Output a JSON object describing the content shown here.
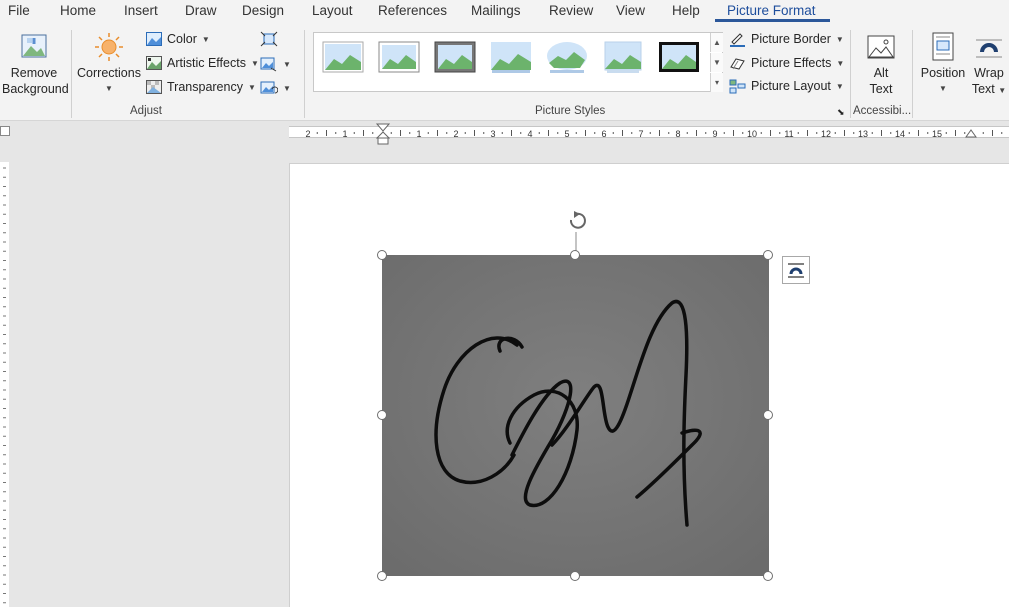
{
  "tabs": [
    {
      "label": "File"
    },
    {
      "label": "Home"
    },
    {
      "label": "Insert"
    },
    {
      "label": "Draw"
    },
    {
      "label": "Design"
    },
    {
      "label": "Layout"
    },
    {
      "label": "References"
    },
    {
      "label": "Mailings"
    },
    {
      "label": "Review"
    },
    {
      "label": "View"
    },
    {
      "label": "Help"
    },
    {
      "label": "Picture Format"
    }
  ],
  "active_tab": "Picture Format",
  "ribbon": {
    "adjust": {
      "remove_background": "Remove Background",
      "remove_background_l1": "Remove",
      "remove_background_l2": "Background",
      "corrections": "Corrections",
      "color": "Color",
      "artistic_effects": "Artistic Effects",
      "transparency": "Transparency",
      "group_label": "Adjust"
    },
    "picture_styles": {
      "group_label": "Picture Styles",
      "picture_border": "Picture Border",
      "picture_effects": "Picture Effects",
      "picture_layout": "Picture Layout",
      "style_count": 7
    },
    "accessibility": {
      "alt_text_l1": "Alt",
      "alt_text_l2": "Text",
      "group_label": "Accessibi..."
    },
    "arrange": {
      "position": "Position",
      "wrap_text_l1": "Wrap",
      "wrap_text_l2": "Text"
    }
  },
  "ruler": {
    "ticks": [
      "2",
      "1",
      "1",
      "2",
      "3",
      "4",
      "5",
      "6",
      "7",
      "8",
      "9",
      "10",
      "11",
      "12",
      "13",
      "14",
      "15"
    ]
  },
  "colors": {
    "accent": "#2b579a",
    "image_bg": "#7a7a7a"
  }
}
